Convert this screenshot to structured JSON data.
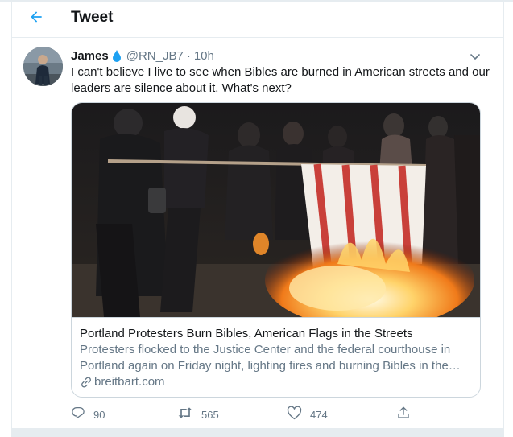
{
  "header": {
    "back_icon": "arrow-left-icon",
    "title": "Tweet"
  },
  "tweet": {
    "author_name": "James",
    "verified_icon": "water-drop-icon",
    "handle": "@RN_JB7",
    "separator": "·",
    "time": "10h",
    "more_icon": "chevron-down-icon",
    "text": "I can't believe I live to see when Bibles are burned in American streets and our leaders are silence about it. What's next?"
  },
  "card": {
    "title": "Portland Protesters Burn Bibles, American Flags in the Streets",
    "description": "Protesters flocked to the Justice Center and the federal courthouse in Portland again on Friday night, lighting fires and burning Bibles in the streets.",
    "domain": "breitbart.com",
    "link_icon": "link-icon"
  },
  "actions": {
    "reply_count": "90",
    "retweet_count": "565",
    "like_count": "474",
    "reply_icon": "reply-icon",
    "retweet_icon": "retweet-icon",
    "like_icon": "heart-icon",
    "share_icon": "share-icon"
  },
  "colors": {
    "accent": "#1da1f2",
    "text": "#14171a",
    "muted": "#657786",
    "border": "#e6ecf0"
  }
}
